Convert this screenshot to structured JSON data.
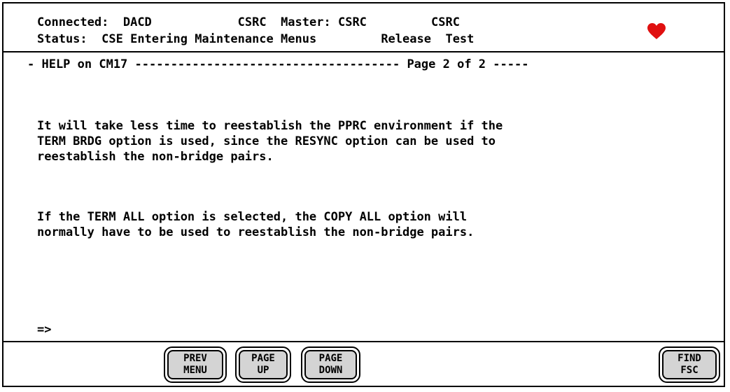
{
  "header": {
    "connected_label": "Connected:",
    "connected_value": "DACD",
    "system_a": "CSRC",
    "master_label": "Master:",
    "master_value": "CSRC",
    "system_b": "CSRC",
    "status_label": "Status:",
    "status_value": "CSE Entering Maintenance Menus",
    "release_label": "Release",
    "release_value": "Test",
    "heart_color": "#e01010"
  },
  "help": {
    "title_line": "- HELP on CM17 ------------------------------------- Page 2 of 2 -----",
    "paragraphs": [
      "It will take less time to reestablish the PPRC environment if the\nTERM BRDG option is used, since the RESYNC option can be used to\nreestablish the non-bridge pairs.",
      "If the TERM ALL option is selected, the COPY ALL option will\nnormally have to be used to reestablish the non-bridge pairs."
    ]
  },
  "command": {
    "prompt": "=>"
  },
  "buttons": {
    "prev_menu": [
      "PREV",
      "MENU"
    ],
    "page_up": [
      "PAGE",
      "UP"
    ],
    "page_down": [
      "PAGE",
      "DOWN"
    ],
    "find_fsc": [
      "FIND",
      "FSC"
    ]
  }
}
